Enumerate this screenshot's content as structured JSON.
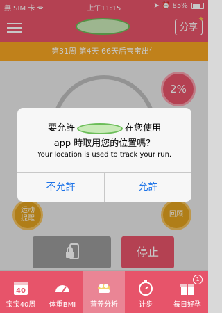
{
  "status_bar": {
    "carrier": "無 SIM 卡",
    "time": "上午11:15",
    "battery": "85%"
  },
  "header": {
    "share_label": "分享"
  },
  "week_info": "第31周 第4天   66天后宝宝出生",
  "progress_percent": "2%",
  "main": {
    "remind_label": "运动提醒",
    "review_label": "回顾",
    "stop_label": "停止"
  },
  "tabs": [
    {
      "label": "宝宝40周",
      "icon": "calendar-40-icon",
      "number": "40"
    },
    {
      "label": "体重BMI",
      "icon": "scale-icon"
    },
    {
      "label": "营养分析",
      "icon": "food-bowl-icon"
    },
    {
      "label": "计步",
      "icon": "stopwatch-icon"
    },
    {
      "label": "每日好孕",
      "icon": "gift-icon",
      "badge": "1"
    }
  ],
  "alert": {
    "line1_pre": "要允許",
    "line1_post": "在您使用",
    "line2": "app 時取用您的位置嗎？",
    "message": "Your location is used to track your run.",
    "deny_label": "不允許",
    "allow_label": "允許"
  }
}
